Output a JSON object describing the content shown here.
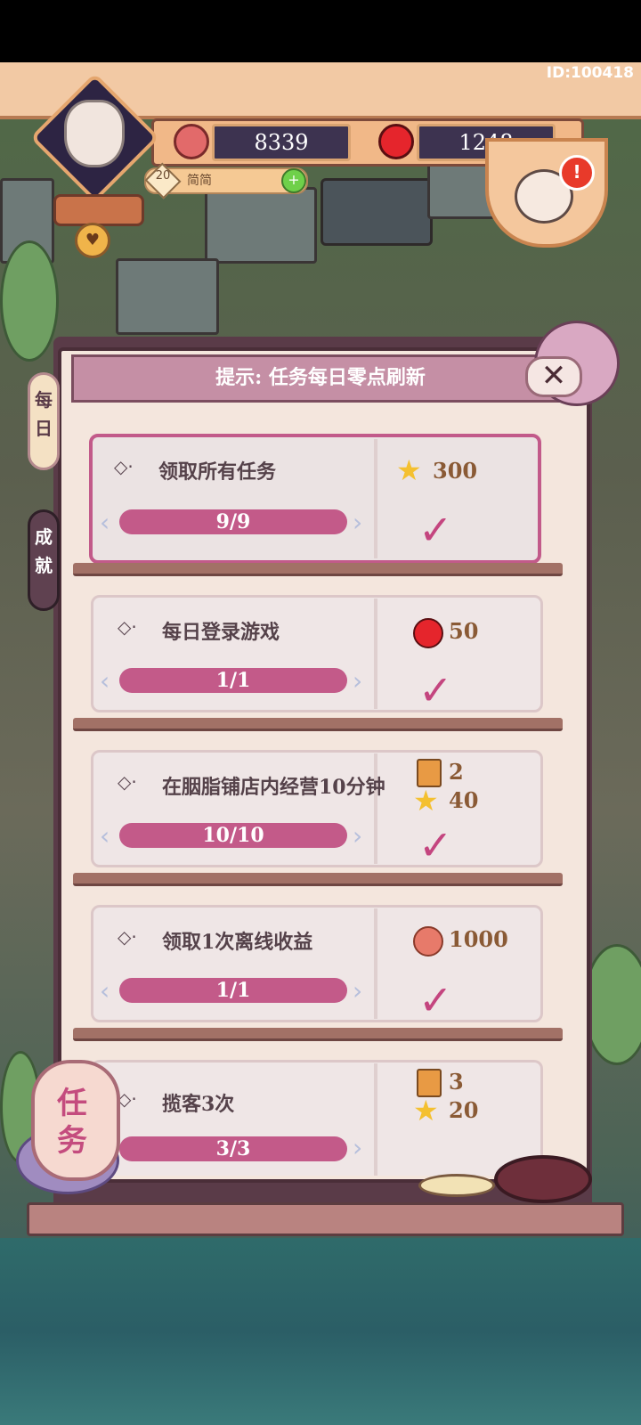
{
  "topbar": {
    "user_id": "ID:100418",
    "hearts": "8339",
    "gems": "1248",
    "level": "20",
    "player_name": "简简",
    "add_symbol": "+",
    "alert_symbol": "!"
  },
  "panel": {
    "hint": "提示: 任务每日零点刷新",
    "close_label": "✕",
    "tabs": [
      {
        "label": "每日"
      },
      {
        "label": "成就"
      }
    ]
  },
  "tasks": [
    {
      "title": "领取所有任务",
      "progress": "9/9",
      "rewards": [
        {
          "icon": "star-icon",
          "amount": "300"
        }
      ],
      "claimed": true
    },
    {
      "title": "每日登录游戏",
      "progress": "1/1",
      "rewards": [
        {
          "icon": "gem-icon",
          "amount": "50"
        }
      ],
      "claimed": true
    },
    {
      "title": "在胭脂铺店内经营10分钟",
      "progress": "10/10",
      "rewards": [
        {
          "icon": "scroll-icon",
          "amount": "2"
        },
        {
          "icon": "star-icon",
          "amount": "40"
        }
      ],
      "claimed": true
    },
    {
      "title": "领取1次离线收益",
      "progress": "1/1",
      "rewards": [
        {
          "icon": "heart-icon",
          "amount": "1000"
        }
      ],
      "claimed": true
    },
    {
      "title": "揽客3次",
      "progress": "3/3",
      "rewards": [
        {
          "icon": "scroll-icon",
          "amount": "3"
        },
        {
          "icon": "star-icon",
          "amount": "20"
        }
      ],
      "claimed": true
    }
  ],
  "lantern": {
    "label": "任务"
  },
  "colors": {
    "accent": "#c35a89",
    "panel": "#f4e6dd",
    "frame": "#4a2e38"
  }
}
